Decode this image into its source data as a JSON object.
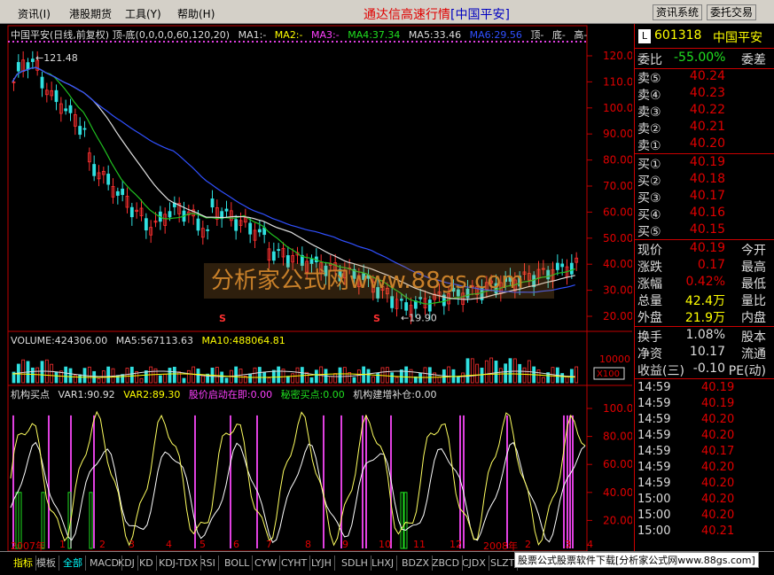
{
  "menu": {
    "items": [
      "资讯(I)",
      "港股期货",
      "工具(Y)",
      "帮助(H)"
    ]
  },
  "window": {
    "title_main": "通达信高速行情",
    "title_sub": "[中国平安]"
  },
  "top_buttons": [
    "资讯系统",
    "委托交易"
  ],
  "chart": {
    "header": "中国平安(日线,前复权) 顶-底(0,0,0,0,60,120,20)",
    "ma_labels": [
      "MA1:-",
      "MA2:-",
      "MA3:-",
      "MA4:37.34",
      "MA5:33.46",
      "MA6:29.56",
      "顶-",
      "底-",
      "高-"
    ],
    "price_axis": [
      "120.0",
      "110.0",
      "100.0",
      "90.00",
      "80.00",
      "70.00",
      "60.00",
      "50.00",
      "40.00",
      "30.00",
      "20.00"
    ],
    "high_label": "121.48",
    "low_label": "19.90",
    "volume_header": "VOLUME:424306.00",
    "volume_ma5": "MA5:567113.63",
    "volume_ma10": "MA10:488064.81",
    "volume_axis": "10000",
    "volume_unit": "X100",
    "indicator_header": "机构买点",
    "indicator_vars": [
      "VAR1:90.92",
      "VAR2:89.30",
      "股价启动在即:0.00",
      "秘密买点:0.00",
      "机构建增补仓:0.00"
    ],
    "indicator_axis": [
      "100.0",
      "80.00",
      "60.00",
      "40.00",
      "20.00"
    ],
    "date_axis": [
      "2007年",
      "1",
      "2",
      "3",
      "4",
      "5",
      "6",
      "7",
      "8",
      "9",
      "10",
      "11",
      "12",
      "2008年",
      "2",
      "3",
      "4"
    ],
    "watermark": "分析家公式网www.88gs.com"
  },
  "right_panel": {
    "code": "601318",
    "name": "中国平安",
    "weibi_label": "委比",
    "weibi_value": "-55.00%",
    "weicha_label": "委差",
    "asks": [
      {
        "label": "卖⑤",
        "price": "40.24"
      },
      {
        "label": "卖④",
        "price": "40.23"
      },
      {
        "label": "卖③",
        "price": "40.22"
      },
      {
        "label": "卖②",
        "price": "40.21"
      },
      {
        "label": "卖①",
        "price": "40.20"
      }
    ],
    "bids": [
      {
        "label": "买①",
        "price": "40.19"
      },
      {
        "label": "买②",
        "price": "40.18"
      },
      {
        "label": "买③",
        "price": "40.17"
      },
      {
        "label": "买④",
        "price": "40.16"
      },
      {
        "label": "买⑤",
        "price": "40.15"
      }
    ],
    "quote": [
      {
        "l": "现价",
        "v": "40.19",
        "r": "今开"
      },
      {
        "l": "涨跌",
        "v": "0.17",
        "r": "最高"
      },
      {
        "l": "涨幅",
        "v": "0.42%",
        "r": "最低"
      },
      {
        "l": "总量",
        "v": "42.4万",
        "r": "量比"
      },
      {
        "l": "外盘",
        "v": "21.9万",
        "r": "内盘"
      }
    ],
    "stats": [
      {
        "l": "换手",
        "v": "1.08%",
        "r": "股本"
      },
      {
        "l": "净资",
        "v": "10.17",
        "r": "流通"
      },
      {
        "l": "收益(三)",
        "v": "-0.10",
        "r": "PE(动)"
      }
    ],
    "ticks": [
      {
        "t": "14:59",
        "p": "40.19"
      },
      {
        "t": "14:59",
        "p": "40.19"
      },
      {
        "t": "14:59",
        "p": "40.20"
      },
      {
        "t": "14:59",
        "p": "40.20"
      },
      {
        "t": "14:59",
        "p": "40.17"
      },
      {
        "t": "14:59",
        "p": "40.20"
      },
      {
        "t": "14:59",
        "p": "40.20"
      },
      {
        "t": "15:00",
        "p": "40.20"
      },
      {
        "t": "15:00",
        "p": "40.20"
      },
      {
        "t": "15:00",
        "p": "40.21"
      }
    ]
  },
  "bottom_tabs": [
    "指标",
    "模板",
    "全部",
    "MACD",
    "KDJ",
    "KD",
    "KDJ-TDX",
    "RSI",
    "BOLL",
    "CYW",
    "CYHT",
    "LYJH",
    "SDLH",
    "LHXJ",
    "BDZX",
    "ZBCD",
    "CJDX",
    "SLZT"
  ],
  "ad_text": "股票公式股票软件下载[分析家公式网www.88gs.com]",
  "colors": {
    "up": "#e00000",
    "ma_blue": "#3050ff",
    "ma_green": "#20c020",
    "ma_white": "#e0e0e0",
    "var1": "#ffff60",
    "var2": "#ffffff",
    "bar_magenta": "#e040e0",
    "bar_green": "#20e020"
  }
}
